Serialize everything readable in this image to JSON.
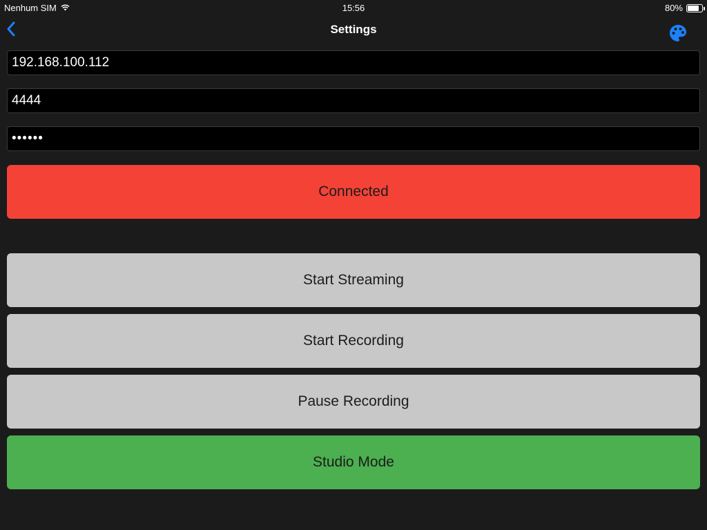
{
  "status_bar": {
    "carrier": "Nenhum SIM",
    "time": "15:56",
    "battery": "80%",
    "battery_level": 0.8,
    "wifi_icon": "wifi-icon"
  },
  "nav": {
    "title": "Settings",
    "back_icon": "chevron-left-icon",
    "palette_icon": "palette-icon"
  },
  "connection": {
    "host_value": "192.168.100.112",
    "port_value": "4444",
    "password_value": "••••••"
  },
  "buttons": {
    "connect": "Connected",
    "start_streaming": "Start Streaming",
    "start_recording": "Start Recording",
    "pause_recording": "Pause Recording",
    "studio_mode": "Studio Mode"
  },
  "colors": {
    "background": "#1b1b1c",
    "accent": "#1a82fb",
    "connected": "#f44237",
    "neutral_button": "#c8c8c8",
    "studio_mode": "#4caf50"
  }
}
